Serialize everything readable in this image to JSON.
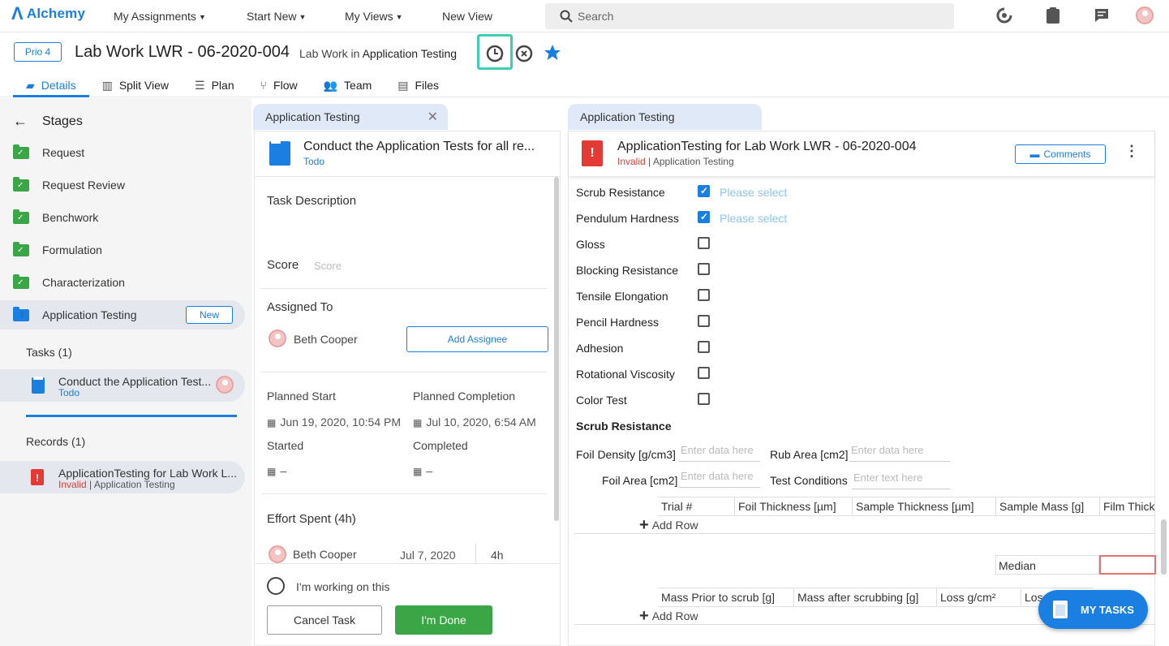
{
  "topnav": {
    "brand": "Alchemy",
    "links": [
      {
        "label": "My Assignments",
        "has_dropdown": true
      },
      {
        "label": "Start New",
        "has_dropdown": true
      },
      {
        "label": "My Views",
        "has_dropdown": true
      },
      {
        "label": "New View",
        "has_dropdown": false
      }
    ],
    "search_placeholder": "Search"
  },
  "header": {
    "priority": "Prio 4",
    "title": "Lab Work LWR - 06-2020-004",
    "subtitle_prefix": "Lab Work in",
    "subtitle_location": "Application Testing",
    "tabs": [
      {
        "label": "Details",
        "icon": "edit-document-icon",
        "active": true
      },
      {
        "label": "Split View",
        "icon": "split-view-icon"
      },
      {
        "label": "Plan",
        "icon": "plan-list-icon"
      },
      {
        "label": "Flow",
        "icon": "flow-branch-icon"
      },
      {
        "label": "Team",
        "icon": "team-icon"
      },
      {
        "label": "Files",
        "icon": "files-icon"
      }
    ],
    "accent_color": "#1a7fe0",
    "highlight_color": "#3dcfb6"
  },
  "sidebar": {
    "heading": "Stages",
    "stages": [
      {
        "label": "Request",
        "status": "done"
      },
      {
        "label": "Request Review",
        "status": "done"
      },
      {
        "label": "Benchwork",
        "status": "done"
      },
      {
        "label": "Formulation",
        "status": "done"
      },
      {
        "label": "Characterization",
        "status": "done"
      },
      {
        "label": "Application Testing",
        "status": "active",
        "badge": "New"
      }
    ],
    "tasks_heading": "Tasks (1)",
    "task": {
      "title": "Conduct the Application Test...",
      "status": "Todo"
    },
    "records_heading": "Records (1)",
    "record": {
      "title": "ApplicationTesting for Lab Work L...",
      "status": "Invalid",
      "location": "Application Testing"
    }
  },
  "middle": {
    "tab_label": "Application Testing",
    "task_title": "Conduct the Application Tests for all re...",
    "task_status": "Todo",
    "description_label": "Task Description",
    "score_label": "Score",
    "score_placeholder": "Score",
    "assigned_label": "Assigned To",
    "assignee": "Beth Cooper",
    "add_assignee": "Add Assignee",
    "planned_start_label": "Planned Start",
    "planned_start": "Jun 19, 2020, 10:54 PM",
    "planned_completion_label": "Planned Completion",
    "planned_completion": "Jul 10, 2020, 6:54 AM",
    "started_label": "Started",
    "started": "–",
    "completed_label": "Completed",
    "completed": "–",
    "effort_label": "Effort Spent (4h)",
    "effort_person": "Beth Cooper",
    "effort_date": "Jul 7, 2020",
    "effort_hours": "4h",
    "working_label": "I'm working on this",
    "cancel_label": "Cancel Task",
    "done_label": "I'm Done",
    "done_color": "#3aa645"
  },
  "right": {
    "tab_label": "Application Testing",
    "record_title": "ApplicationTesting for Lab Work LWR - 06-2020-004",
    "record_status": "Invalid",
    "record_location": "Application Testing",
    "comments_label": "Comments",
    "tests": [
      {
        "label": "Scrub Resistance",
        "checked": true,
        "placeholder": "Please select"
      },
      {
        "label": "Pendulum Hardness",
        "checked": true,
        "placeholder": "Please select"
      },
      {
        "label": "Gloss",
        "checked": false
      },
      {
        "label": "Blocking Resistance",
        "checked": false
      },
      {
        "label": "Tensile Elongation",
        "checked": false
      },
      {
        "label": "Pencil Hardness",
        "checked": false
      },
      {
        "label": "Adhesion",
        "checked": false
      },
      {
        "label": "Rotational Viscosity",
        "checked": false
      },
      {
        "label": "Color Test",
        "checked": false
      }
    ],
    "section_heading": "Scrub Resistance",
    "fields": {
      "foil_density_label": "Foil Density [g/cm3]",
      "foil_density_ph": "Enter data here",
      "rub_area_label": "Rub Area [cm2]",
      "rub_area_ph": "Enter data here",
      "foil_area_label": "Foil Area [cm2]",
      "foil_area_ph": "Enter data here",
      "test_conditions_label": "Test Conditions",
      "test_conditions_ph": "Enter text here"
    },
    "table1_headers": [
      "Trial #",
      "Foil Thickness [µm]",
      "Sample Thickness [µm]",
      "Sample Mass [g]",
      "Film Thick"
    ],
    "add_row": "Add Row",
    "median_label": "Median",
    "table2_headers": [
      "Mass Prior to scrub [g]",
      "Mass after scrubbing [g]",
      "Loss g/cm²",
      "Los"
    ],
    "add_row_2": "Add Row"
  },
  "fab": {
    "label": "MY TASKS"
  }
}
